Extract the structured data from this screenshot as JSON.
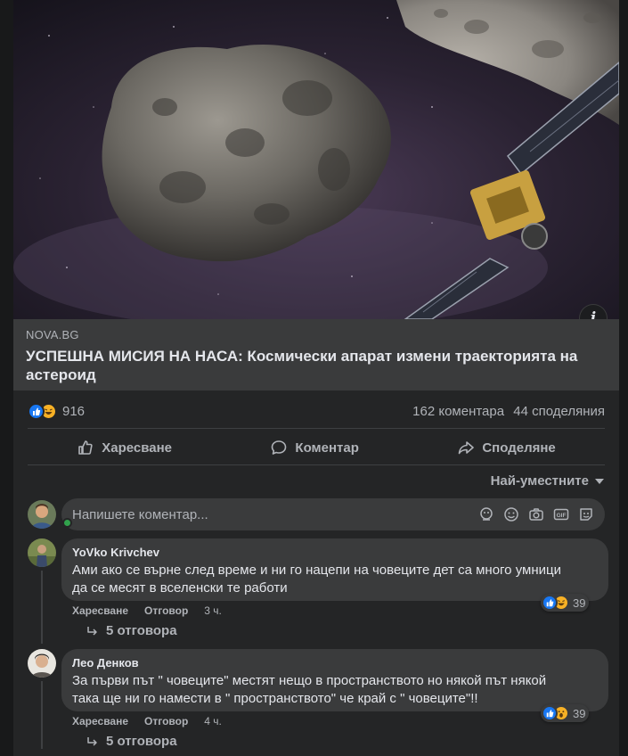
{
  "link_preview": {
    "domain": "NOVA.BG",
    "headline": "УСПЕШНА МИСИЯ НА НАСА: Космически апарат измени траекторията на астероид",
    "info_icon": "info-icon"
  },
  "stats": {
    "reaction_count": "916",
    "comments": "162 коментара",
    "shares": "44 споделяния"
  },
  "actions": {
    "like": "Харесване",
    "comment": "Коментар",
    "share": "Споделяне"
  },
  "sort": {
    "label": "Най-уместните"
  },
  "composer": {
    "placeholder": "Напишете коментар..."
  },
  "comments": [
    {
      "author": "YoVko Krivchev",
      "text_line1": "Ами ако се върне след време и ни го нацепи на човеците дет са много умници",
      "text_line2": "да се месят в вселенски те работи",
      "like": "Харесване",
      "reply": "Отговор",
      "time": "3 ч.",
      "reactions": "39",
      "replies": "5 отговора"
    },
    {
      "author": "Лео Денков",
      "text_line1": "За първи път \" човеците\" местят нещо в пространството но някой път някой",
      "text_line2": "така ще ни го намести в \" пространството\" че край с \" човеците\"!!",
      "like": "Харесване",
      "reply": "Отговор",
      "time": "4 ч.",
      "reactions": "39",
      "replies": "5 отговора"
    }
  ],
  "colors": {
    "background": "#18191a",
    "card": "#242526",
    "surface": "#3a3b3c",
    "text_primary": "#e4e6eb",
    "text_secondary": "#b0b3b8",
    "like_blue": "#1877f2",
    "reaction_yellow": "#f7b125",
    "online_green": "#31a24c"
  }
}
